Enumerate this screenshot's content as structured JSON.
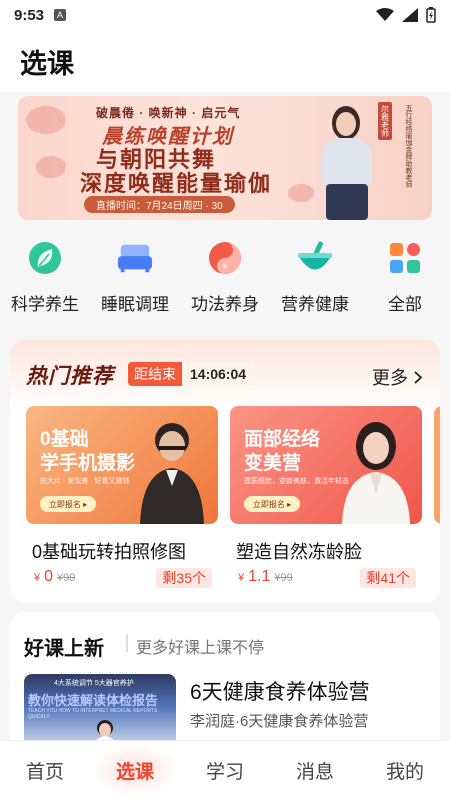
{
  "status_bar": {
    "time": "9:53",
    "notification_glyph": "A"
  },
  "header": {
    "title": "选课"
  },
  "banner": {
    "line1": "破晨倦 · 唤新神 · 启元气",
    "line2": "晨练唤醒计划",
    "line3": "与朝阳共舞",
    "line4": "深度唤醒能量瑜伽",
    "live_time": "直播时间：7月24日周四 · 30",
    "teacher_tag": "尔雅老师",
    "teacher_desc": "五行经络瑜伽金牌助教老师"
  },
  "categories": [
    {
      "label": "科学养生",
      "icon": "leaf-icon"
    },
    {
      "label": "睡眠调理",
      "icon": "bed-icon"
    },
    {
      "label": "功法养身",
      "icon": "yinyang-icon"
    },
    {
      "label": "营养健康",
      "icon": "bowl-icon"
    },
    {
      "label": "全部",
      "icon": "grid-icon"
    }
  ],
  "hot": {
    "title": "热门推荐",
    "countdown_label": "距结束",
    "countdown_time": "14:06:04",
    "more_label": "更多",
    "courses": [
      {
        "thumb_title1": "0基础",
        "thumb_title2": "学手机摄影",
        "thumb_sub": "拍大片 · 发现美 · 好看又赚钱",
        "thumb_btn": "立即报名 ▸",
        "name": "0基础玩转拍照修图",
        "price": "0",
        "orig_price": "¥99",
        "remaining": "剩35个",
        "colors": {
          "from": "#f8b37a",
          "to": "#f07a3e"
        }
      },
      {
        "thumb_title1": "面部经络",
        "thumb_title2": "变美营",
        "thumb_sub": "摸筋瘦脸，逆龄美肤，激活年轻态",
        "thumb_btn": "立即报名 ▸",
        "name": "塑造自然冻龄脸",
        "price": "1.1",
        "orig_price": "¥99",
        "remaining": "剩41个",
        "colors": {
          "from": "#f98b7c",
          "to": "#f1564a"
        }
      }
    ]
  },
  "new_courses": {
    "title": "好课上新",
    "subtitle": "更多好课上课不停",
    "item": {
      "thumb_top": "4大系统调节 5大器官养护",
      "thumb_title": "教你快速解读体检报告",
      "thumb_en": "TEACH YOU HOW TO INTERPRET MEDICAL REPORTS QUICKLY",
      "name": "6天健康食养体验营",
      "desc": "李润庭·6天健康食养体验营"
    }
  },
  "tabbar": {
    "tabs": [
      "首页",
      "选课",
      "学习",
      "消息",
      "我的"
    ],
    "active_index": 1
  },
  "colors": {
    "accent": "#f0442c",
    "hot_title": "#6b1c0f"
  }
}
